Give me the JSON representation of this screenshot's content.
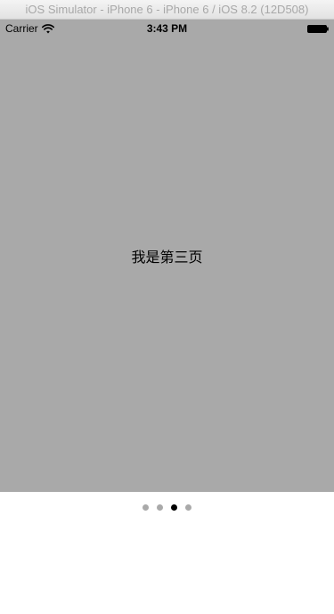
{
  "window": {
    "title": "iOS Simulator - iPhone 6 - iPhone 6 / iOS 8.2 (12D508)"
  },
  "status_bar": {
    "carrier": "Carrier",
    "time": "3:43 PM",
    "icons": [
      "wifi-icon",
      "battery-icon"
    ]
  },
  "page": {
    "label": "我是第三页",
    "background_color": "#a9a9a9"
  },
  "page_control": {
    "page_count": 4,
    "current_page": 3,
    "active_color": "#000000",
    "inactive_color": "#a9a9a9"
  }
}
